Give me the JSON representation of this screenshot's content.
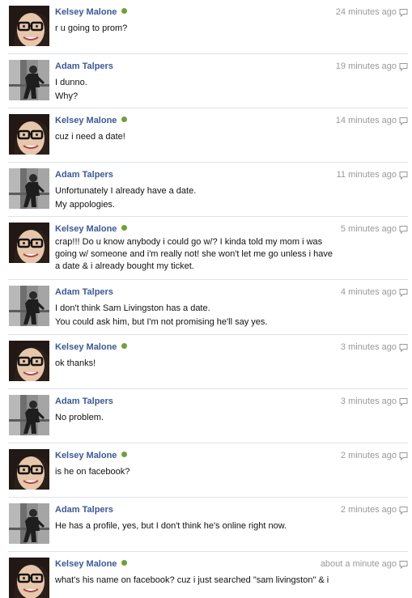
{
  "messages": [
    {
      "author": "Kelsey Malone",
      "online": true,
      "time": "24 minutes ago",
      "lines": [
        "r u going to prom?"
      ]
    },
    {
      "author": "Adam Talpers",
      "online": false,
      "time": "19 minutes ago",
      "lines": [
        "I dunno.",
        "Why?"
      ]
    },
    {
      "author": "Kelsey Malone",
      "online": true,
      "time": "14 minutes ago",
      "lines": [
        "cuz i need a date!"
      ]
    },
    {
      "author": "Adam Talpers",
      "online": false,
      "time": "11 minutes ago",
      "lines": [
        "Unfortunately I already have a date.",
        "My appologies."
      ]
    },
    {
      "author": "Kelsey Malone",
      "online": true,
      "time": "5 minutes ago",
      "lines": [
        "crap!!! Do u know anybody i could go w/? I kinda told my mom i was going w/ someone and i'm really not! she won't let me go unless i have a date & i already bought my ticket."
      ]
    },
    {
      "author": "Adam Talpers",
      "online": false,
      "time": "4 minutes ago",
      "lines": [
        "I don't think Sam Livingston has a date.",
        "You could ask him, but I'm not promising he'll say yes."
      ]
    },
    {
      "author": "Kelsey Malone",
      "online": true,
      "time": "3 minutes ago",
      "lines": [
        "ok thanks!"
      ]
    },
    {
      "author": "Adam Talpers",
      "online": false,
      "time": "3 minutes ago",
      "lines": [
        "No problem."
      ]
    },
    {
      "author": "Kelsey Malone",
      "online": true,
      "time": "2 minutes ago",
      "lines": [
        "is he on facebook?"
      ]
    },
    {
      "author": "Adam Talpers",
      "online": false,
      "time": "2 minutes ago",
      "lines": [
        "He has a profile, yes, but I don't think he's online right now."
      ]
    },
    {
      "author": "Kelsey Malone",
      "online": true,
      "time": "about a minute ago",
      "lines": [
        "what's his name on facebook? cuz i just searched \"sam livingston\" & i"
      ]
    }
  ],
  "icons": {
    "online": "online-status-dot",
    "comment": "comment-bubble-icon",
    "kelsey_avatar": "profile-photo-woman-glasses",
    "adam_avatar": "profile-photo-dark-figure"
  },
  "colors": {
    "author_link": "#3b5998",
    "timestamp": "#999999",
    "online_dot": "#6fa136",
    "divider": "#e0e3ea"
  }
}
